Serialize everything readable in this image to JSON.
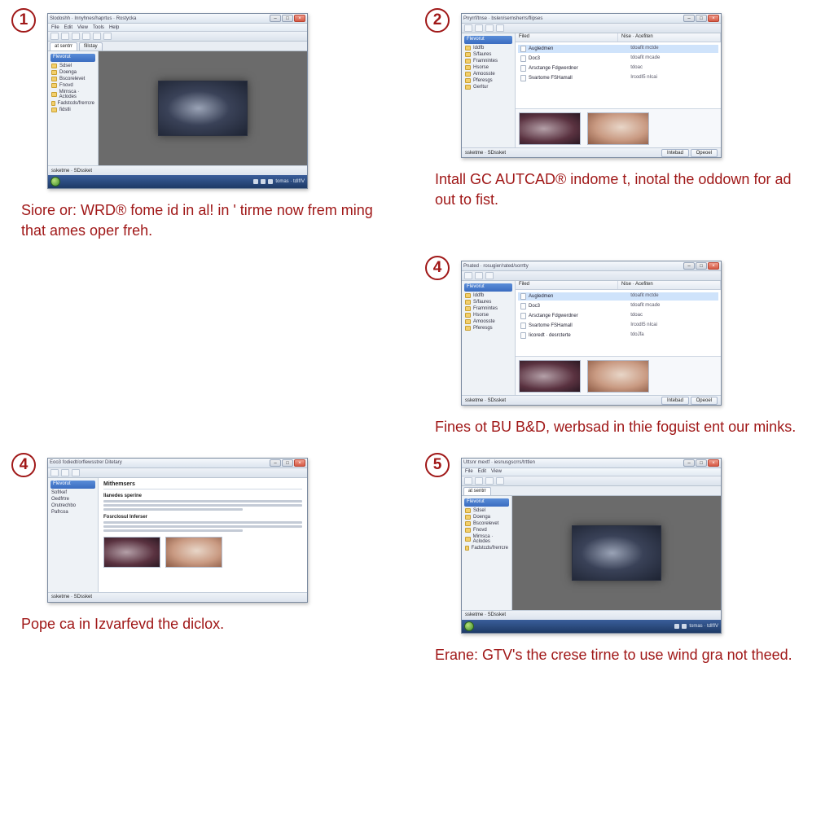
{
  "steps": [
    {
      "number": "1",
      "caption": "Siore or: WRD® fome id in al! in ' tirme now frem ming that ames oper freh.",
      "view": "viewer",
      "title": "Slodoshh · Innyhnes/haprtus · Rostycka"
    },
    {
      "number": "2",
      "caption": "Intall GC AUTCAD® indome t, inotal the oddown for ad out to fist.",
      "view": "explorer",
      "title": "Pnyrrf/tnse · bslen/sernsherrs/flipses",
      "col1": "Filed",
      "col2": "Nise · Acefiten",
      "btn1": "Intebad",
      "btn2": "Opeoel"
    },
    {
      "number": "4",
      "caption": "Fines ot BU B&D, werbsad in thie foguist ent our minks.",
      "view": "explorer",
      "title": "Pnated · rosugier/rated/sorrtty",
      "col1": "Filed",
      "col2": "Nise · Acefiten",
      "btn1": "Intebad",
      "btn2": "Opeoel"
    },
    {
      "number": "4",
      "caption": "Pope ca in Izvarfevd the diclox.",
      "view": "document",
      "title": "Eoo3 fodiedt/orflewsstrer Ditetary",
      "docTitle": "Mithemsers",
      "sectionsA": "Ilanedes sperine",
      "sectionsB": "Fosrclosul Inferser"
    },
    {
      "number": "5",
      "caption": "Erane: GTV's the crese tirne to use wind gra not theed.",
      "view": "viewer",
      "title": "Uttsnr mextf · iesnusgscrrs/trttlen"
    }
  ],
  "menus": [
    "File",
    "Edit",
    "View",
    "Tools",
    "Help"
  ],
  "sidebarHead": "Flevorut",
  "sidebarItems": [
    "Sdsel",
    "Doenga",
    "Bscorelevet",
    "Fnovd",
    "Mirnsca · Aclodes",
    "Fadstcds/frerrcre",
    "fidstli"
  ],
  "explorerItems": [
    "Iddfb",
    "S/faures",
    "Framnintes",
    "Hsorse",
    "Amoosste",
    "Pferesgs",
    "Gerltur"
  ],
  "files": [
    {
      "name": "Augledmen",
      "meta": "tdoafit  mctde"
    },
    {
      "name": "Doc3",
      "meta": "tdoafit  mcade"
    },
    {
      "name": "Arsctange Fdgwerdner",
      "meta": "tdoac"
    },
    {
      "name": "Svartome FSHamall",
      "meta": "IrcodI5  nIcai"
    },
    {
      "name": "Iicoredt · desrcterte",
      "meta": "tdoJfa"
    }
  ],
  "docSidebar": [
    "Sofrkef",
    "Oedfrtre",
    "Orutrechbo",
    "Pafrcoa"
  ],
  "status": "ssketme · SDssket",
  "trayTime": "tomas · tdIfIV",
  "tabs": [
    "at sentrr",
    "fillstay"
  ]
}
